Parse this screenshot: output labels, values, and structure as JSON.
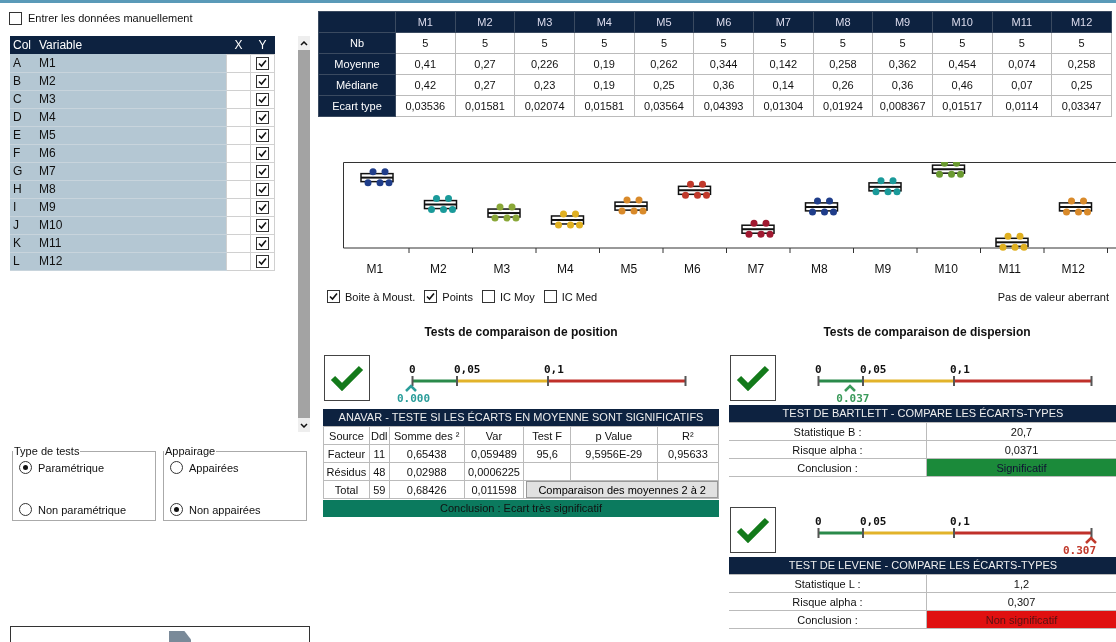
{
  "manual_entry": {
    "label": "Entrer les données manuellement",
    "checked": false
  },
  "variables": {
    "columns": [
      "Col",
      "Variable",
      "X",
      "Y"
    ],
    "rows": [
      {
        "col": "A",
        "name": "M1",
        "y": true
      },
      {
        "col": "B",
        "name": "M2",
        "y": true
      },
      {
        "col": "C",
        "name": "M3",
        "y": true
      },
      {
        "col": "D",
        "name": "M4",
        "y": true
      },
      {
        "col": "E",
        "name": "M5",
        "y": true
      },
      {
        "col": "F",
        "name": "M6",
        "y": true
      },
      {
        "col": "G",
        "name": "M7",
        "y": true
      },
      {
        "col": "H",
        "name": "M8",
        "y": true
      },
      {
        "col": "I",
        "name": "M9",
        "y": true
      },
      {
        "col": "J",
        "name": "M10",
        "y": true
      },
      {
        "col": "K",
        "name": "M11",
        "y": true
      },
      {
        "col": "L",
        "name": "M12",
        "y": true
      }
    ]
  },
  "test_type": {
    "title": "Type de tests",
    "options": [
      {
        "label": "Paramétrique",
        "selected": true
      },
      {
        "label": "Non paramétrique",
        "selected": false
      }
    ]
  },
  "pairing": {
    "title": "Appairage",
    "options": [
      {
        "label": "Appairées",
        "selected": false
      },
      {
        "label": "Non appairées",
        "selected": true
      }
    ]
  },
  "stats": {
    "columns": [
      "M1",
      "M2",
      "M3",
      "M4",
      "M5",
      "M6",
      "M7",
      "M8",
      "M9",
      "M10",
      "M11",
      "M12"
    ],
    "rows": [
      {
        "label": "Nb",
        "values": [
          "5",
          "5",
          "5",
          "5",
          "5",
          "5",
          "5",
          "5",
          "5",
          "5",
          "5",
          "5"
        ]
      },
      {
        "label": "Moyenne",
        "values": [
          "0,41",
          "0,27",
          "0,226",
          "0,19",
          "0,262",
          "0,344",
          "0,142",
          "0,258",
          "0,362",
          "0,454",
          "0,074",
          "0,258"
        ]
      },
      {
        "label": "Médiane",
        "values": [
          "0,42",
          "0,27",
          "0,23",
          "0,19",
          "0,25",
          "0,36",
          "0,14",
          "0,26",
          "0,36",
          "0,46",
          "0,07",
          "0,25"
        ]
      },
      {
        "label": "Ecart type",
        "values": [
          "0,03536",
          "0,01581",
          "0,02074",
          "0,01581",
          "0,03564",
          "0,04393",
          "0,01304",
          "0,01924",
          "0,008367",
          "0,01517",
          "0,0114",
          "0,03347"
        ]
      }
    ]
  },
  "boxplot": {
    "groups": [
      {
        "label": "M1",
        "color": "#1f3d8a"
      },
      {
        "label": "M2",
        "color": "#1a9a9a"
      },
      {
        "label": "M3",
        "color": "#8aa838"
      },
      {
        "label": "M4",
        "color": "#e0b020"
      },
      {
        "label": "M5",
        "color": "#d98a2a"
      },
      {
        "label": "M6",
        "color": "#c0392b"
      },
      {
        "label": "M7",
        "color": "#a01830"
      },
      {
        "label": "M8",
        "color": "#1f3d8a"
      },
      {
        "label": "M9",
        "color": "#1a9a9a"
      },
      {
        "label": "M10",
        "color": "#6a9a30"
      },
      {
        "label": "M11",
        "color": "#e0b020"
      },
      {
        "label": "M12",
        "color": "#d98a2a"
      }
    ]
  },
  "plot_options": [
    {
      "label": "Boite à Moust.",
      "checked": true
    },
    {
      "label": "Points",
      "checked": true
    },
    {
      "label": "IC Moy",
      "checked": false
    },
    {
      "label": "IC Med",
      "checked": false
    }
  ],
  "outlier_note": "Pas de valeur aberrant",
  "position_title": "Tests de comparaison de position",
  "dispersion_title": "Tests de comparaison de dispersion",
  "anova": {
    "gauge": {
      "ticks": [
        "0",
        "0,05",
        "0,1"
      ],
      "reading": "0.000",
      "color": "#2a9d9a"
    },
    "title": "ANAVAR - TESTE SI LES ÉCARTS EN MOYENNE SONT SIGNIFICATIFS",
    "columns": [
      "Source",
      "Ddl",
      "Somme des ²",
      "Var",
      "Test F",
      "p Value",
      "R²"
    ],
    "rows": [
      [
        "Facteur",
        "11",
        "0,65438",
        "0,059489",
        "95,6",
        "9,5956E-29",
        "0,95633"
      ],
      [
        "Résidus",
        "48",
        "0,02988",
        "0,0006225",
        "",
        "",
        ""
      ],
      [
        "Total",
        "59",
        "0,68426",
        "0,011598"
      ]
    ],
    "button": "Comparaison des moyennes 2 à 2",
    "conclusion": "Conclusion : Ecart très significatif"
  },
  "tests": [
    {
      "gauge": {
        "ticks": [
          "0",
          "0,05",
          "0,1"
        ],
        "reading": "0.037",
        "color": "#3a9a5a"
      },
      "title": "TEST DE BARTLETT - COMPARE LES ÉCARTS-TYPES",
      "rows": [
        {
          "label": "Statistique B :",
          "value": "20,7"
        },
        {
          "label": "Risque alpha :",
          "value": "0,0371"
        },
        {
          "label": "Conclusion :",
          "value": "Significatif",
          "significant": true
        }
      ]
    },
    {
      "gauge": {
        "ticks": [
          "0",
          "0,05",
          "0,1"
        ],
        "reading": "0.307",
        "color": "#c0392b"
      },
      "title": "TEST DE LEVENE - COMPARE LES ÉCARTS-TYPES",
      "rows": [
        {
          "label": "Statistique L :",
          "value": "1,2"
        },
        {
          "label": "Risque alpha :",
          "value": "0,307"
        },
        {
          "label": "Conclusion :",
          "value": "Non significatif",
          "significant": false
        }
      ]
    }
  ]
}
